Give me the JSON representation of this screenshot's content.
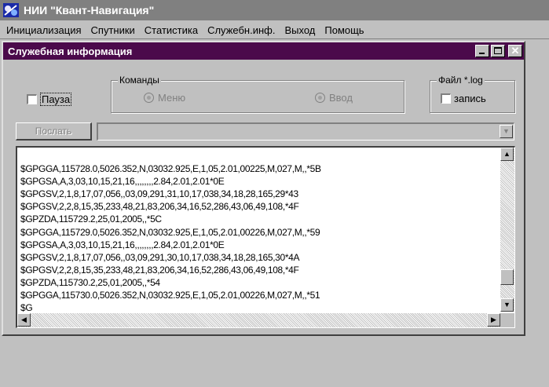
{
  "app": {
    "title": "НИИ \"Квант-Навигация\""
  },
  "menu": [
    "Инициализация",
    "Спутники",
    "Статистика",
    "Служебн.инф.",
    "Выход",
    "Помощь"
  ],
  "window": {
    "title": "Служебная информация",
    "close_glyph": "✕"
  },
  "pause": {
    "label": "Пауза",
    "checked": false
  },
  "commands": {
    "legend": "Команды",
    "option_menu": "Меню",
    "option_input": "Ввод"
  },
  "logfile": {
    "legend": "Файл *.log",
    "record_label": "запись",
    "checked": false
  },
  "send_button": "Послать",
  "combo": {
    "value": ""
  },
  "log_lines": [
    "$GPGGA,115728.0,5026.352,N,03032.925,E,1,05,2.01,00225,M,027,M,,*5B",
    "$GPGSA,A,3,03,10,15,21,16,,,,,,,,2.84,2.01,2.01*0E",
    "$GPGSV,2,1,8,17,07,056,,03,09,291,31,10,17,038,34,18,28,165,29*43",
    "$GPGSV,2,2,8,15,35,233,48,21,83,206,34,16,52,286,43,06,49,108,*4F",
    "$GPZDA,115729.2,25,01,2005,,*5C",
    "$GPGGA,115729.0,5026.352,N,03032.925,E,1,05,2.01,00226,M,027,M,,*59",
    "$GPGSA,A,3,03,10,15,21,16,,,,,,,,2.84,2.01,2.01*0E",
    "$GPGSV,2,1,8,17,07,056,,03,09,291,30,10,17,038,34,18,28,165,30*4A",
    "$GPGSV,2,2,8,15,35,233,48,21,83,206,34,16,52,286,43,06,49,108,*4F",
    "$GPZDA,115730.2,25,01,2005,,*54",
    "$GPGGA,115730.0,5026.352,N,03032.925,E,1,05,2.01,00226,M,027,M,,*51",
    "$G"
  ],
  "glyphs": {
    "up": "▲",
    "down": "▼",
    "left": "◀",
    "right": "▶"
  }
}
